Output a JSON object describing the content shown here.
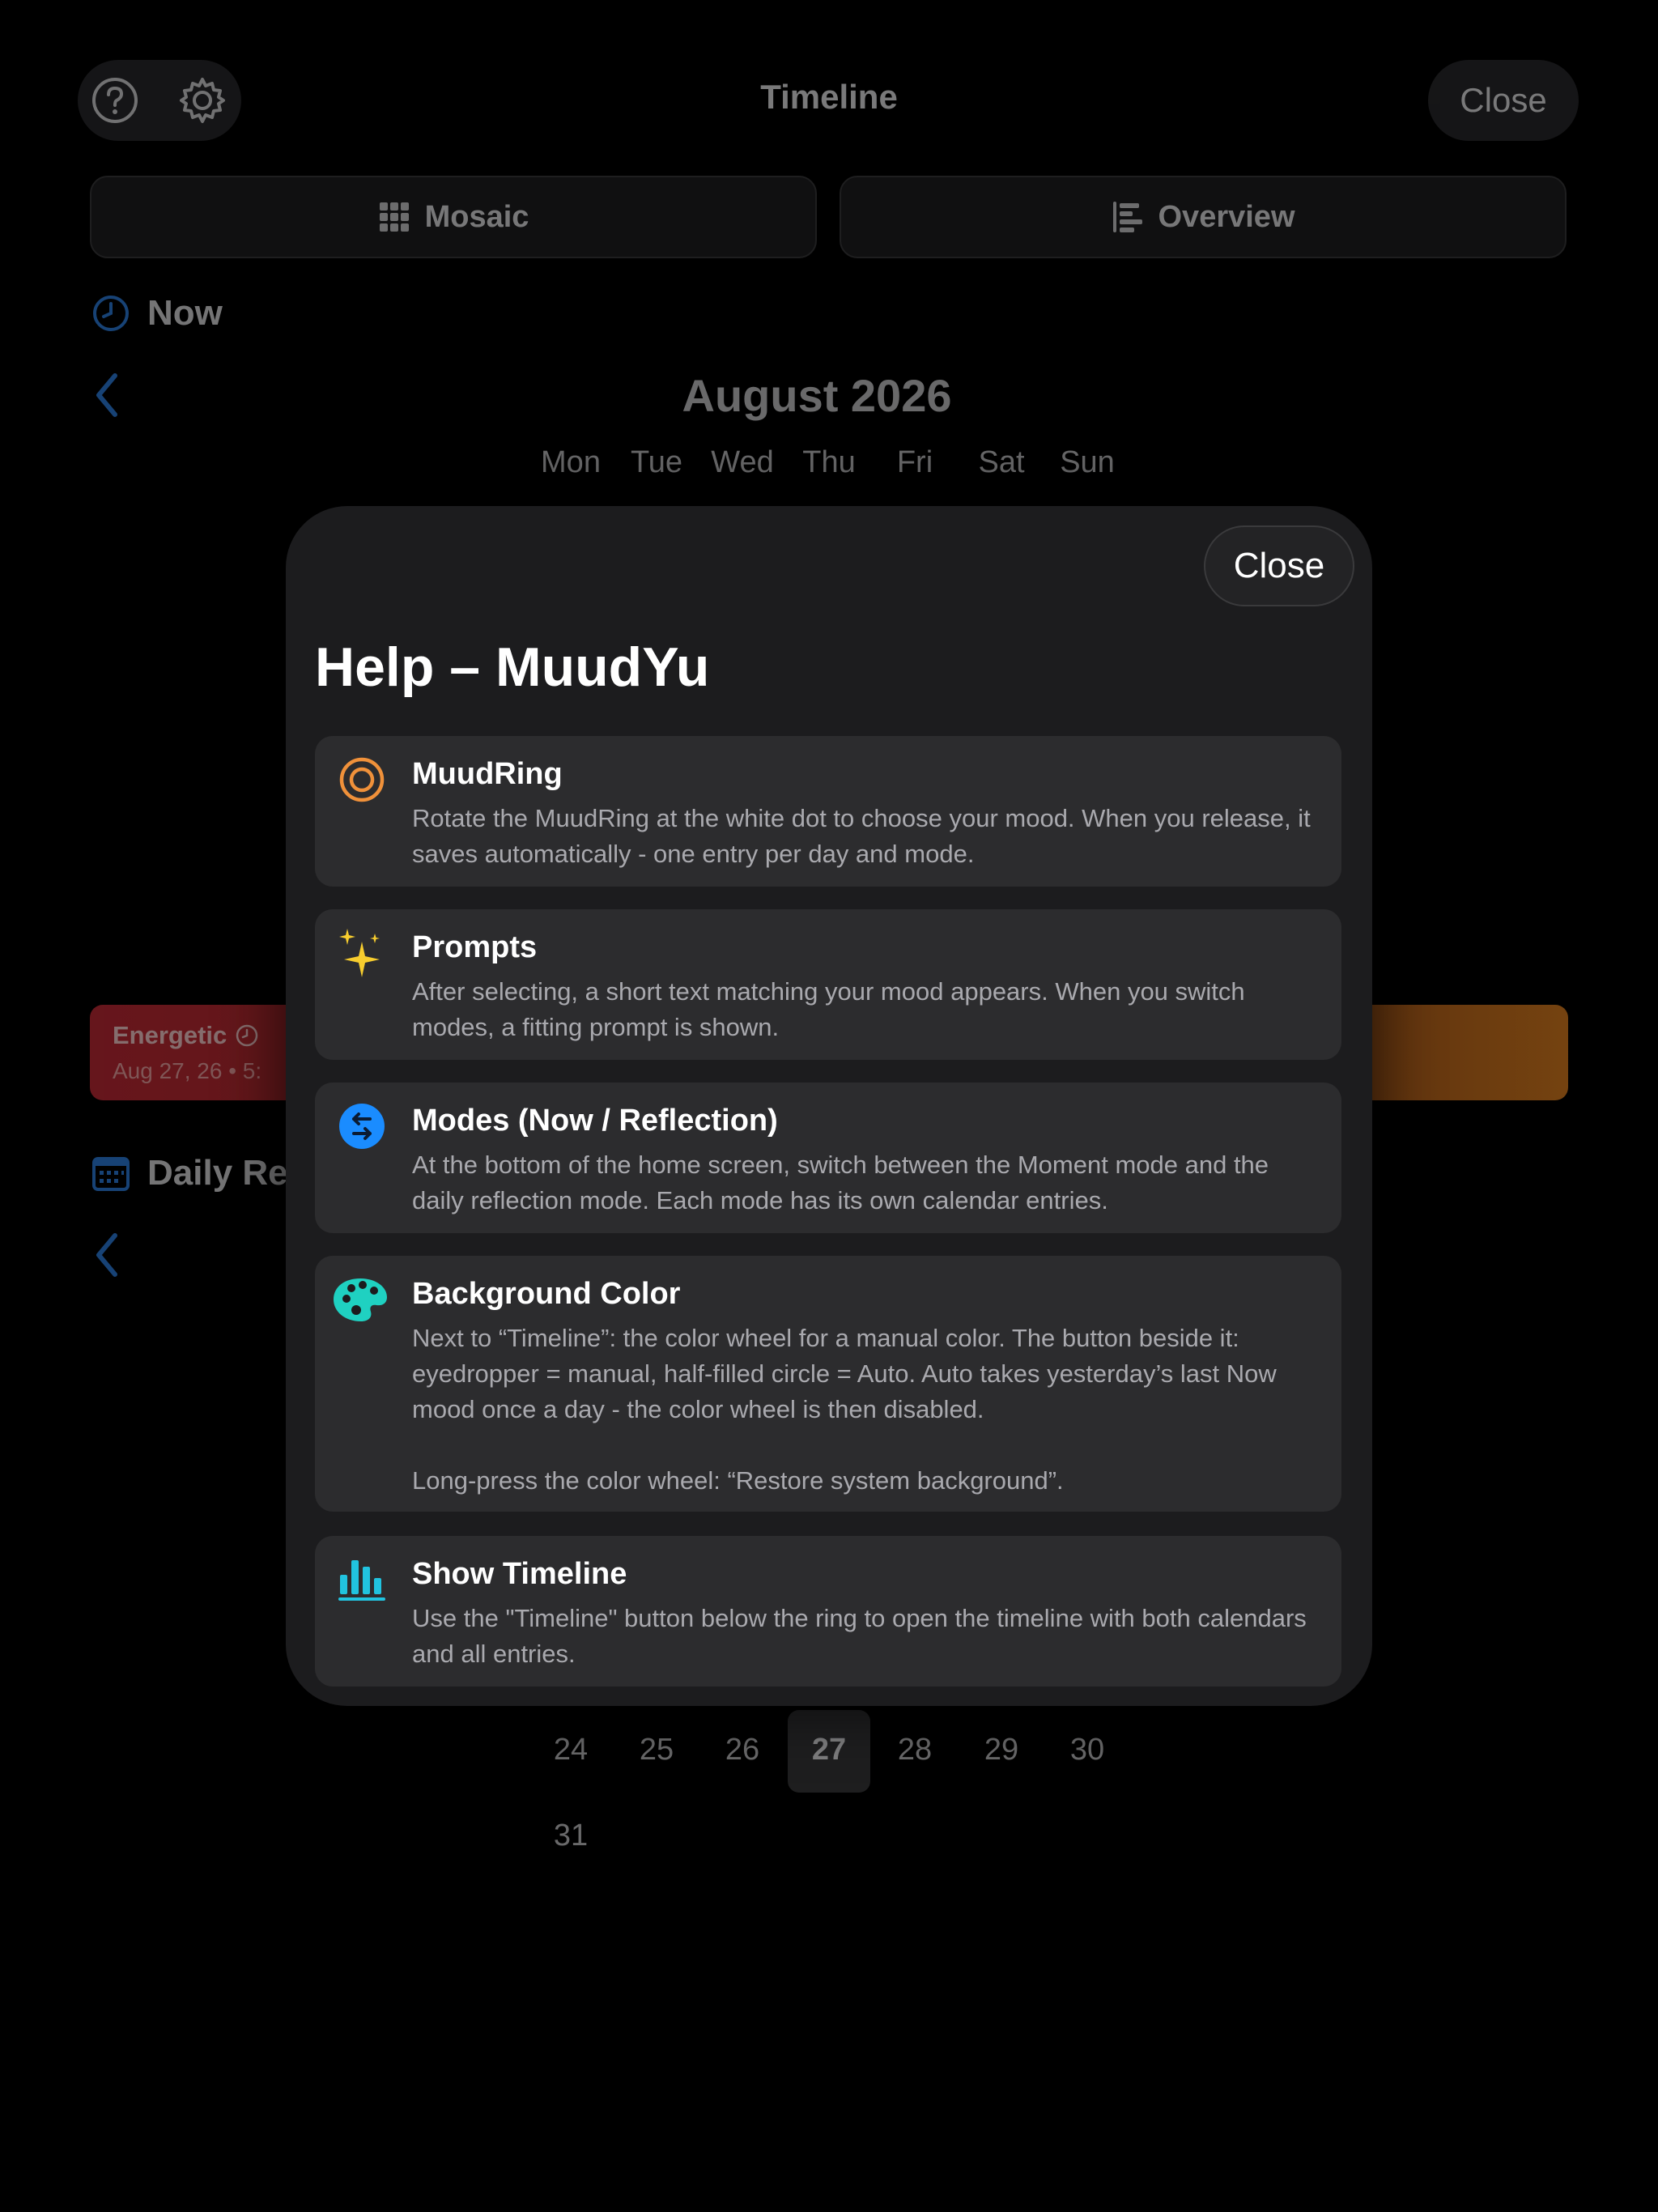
{
  "background": {
    "title": "Timeline",
    "close_label": "Close",
    "tabs": [
      {
        "label": "Mosaic",
        "icon": "grid-icon"
      },
      {
        "label": "Overview",
        "icon": "list-bars-icon"
      }
    ],
    "now_section": {
      "label": "Now",
      "icon": "clock-icon"
    },
    "calendar": {
      "month": "August 2026",
      "weekdays": [
        "Mon",
        "Tue",
        "Wed",
        "Thu",
        "Fri",
        "Sat",
        "Sun"
      ],
      "visible_days": [
        "24",
        "25",
        "26",
        "27",
        "28",
        "29",
        "30",
        "31"
      ],
      "today": "27"
    },
    "entry": {
      "mood": "Energetic",
      "date": "Aug 27, 26 • 5:",
      "accent_start": "#c52a36",
      "accent_end": "#e0801e"
    },
    "daily_section": {
      "label": "Daily Re",
      "icon": "calendar-icon"
    }
  },
  "modal": {
    "close_label": "Close",
    "title": "Help – MuudYu",
    "items": [
      {
        "icon": "target-ring-icon",
        "icon_color": "#f0913a",
        "title": "MuudRing",
        "body": "Rotate the MuudRing at the white dot to choose your mood. When you release, it saves automatically - one entry per day and mode."
      },
      {
        "icon": "sparkles-icon",
        "icon_color": "#f7cd2e",
        "title": "Prompts",
        "body": "After selecting, a short text matching your mood appears. When you switch modes, a fitting prompt is shown."
      },
      {
        "icon": "swap-arrows-icon",
        "icon_color": "#1a8cff",
        "title": "Modes (Now / Reflection)",
        "body": "At the bottom of the home screen, switch between the Moment mode and the daily reflection mode. Each mode has its own calendar entries."
      },
      {
        "icon": "palette-icon",
        "icon_color": "#1fd1c1",
        "title": "Background Color",
        "body": "Next to “Timeline”: the color wheel for a manual color. The button beside it: eyedropper = manual, half-filled circle = Auto. Auto takes yesterday’s last Now mood once a day - the color wheel is then disabled.\n\nLong-press the color wheel: “Restore system background”."
      },
      {
        "icon": "bar-chart-icon",
        "icon_color": "#21c3df",
        "title": "Show Timeline",
        "body": "Use the \"Timeline\" button below the ring to open the timeline with both calendars and all entries."
      }
    ]
  }
}
